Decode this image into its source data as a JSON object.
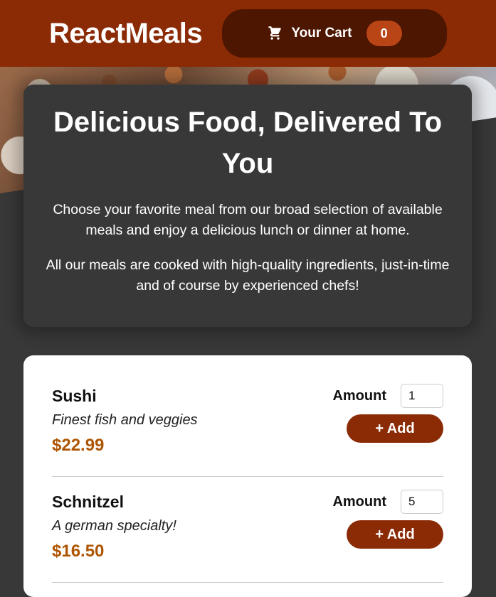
{
  "header": {
    "brand": "ReactMeals",
    "cart_label": "Your Cart",
    "cart_count": "0"
  },
  "summary": {
    "title": "Delicious Food, Delivered To You",
    "paragraph1": "Choose your favorite meal from our broad selection of available meals and enjoy a delicious lunch or dinner at home.",
    "paragraph2": "All our meals are cooked with high-quality ingredients, just-in-time and of course by experienced chefs!"
  },
  "meals": [
    {
      "name": "Sushi",
      "description": "Finest fish and veggies",
      "price": "$22.99",
      "amount_label": "Amount",
      "amount_value": "1",
      "add_label": "+ Add"
    },
    {
      "name": "Schnitzel",
      "description": "A german specialty!",
      "price": "$16.50",
      "amount_label": "Amount",
      "amount_value": "5",
      "add_label": "+ Add"
    }
  ],
  "colors": {
    "header": "#8a2b06",
    "cart_button": "#4d1601",
    "badge": "#b94517",
    "price": "#ad5502",
    "background": "#383838"
  },
  "icons": {
    "cart": "cart-icon"
  }
}
